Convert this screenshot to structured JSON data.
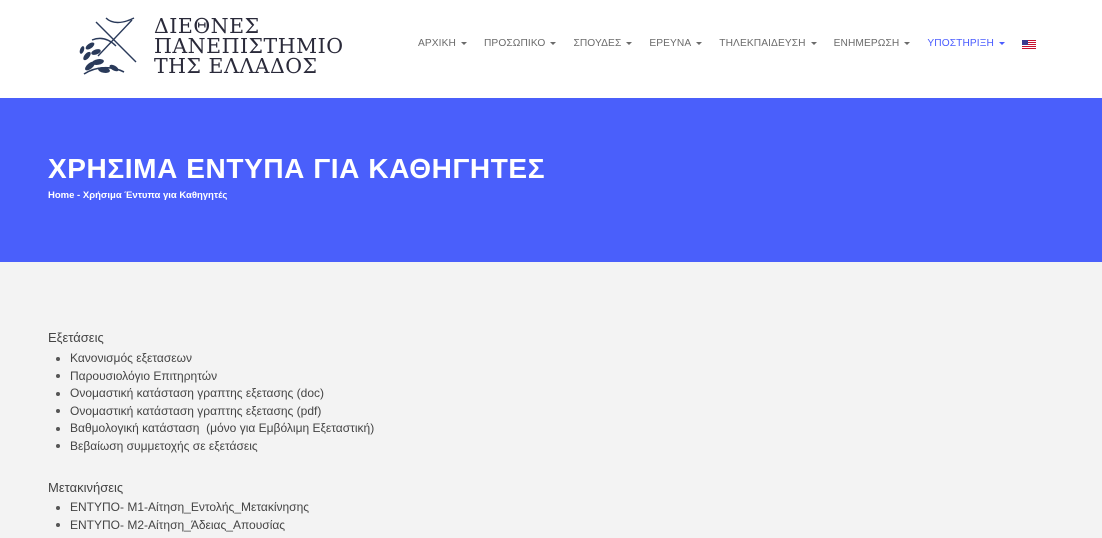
{
  "header": {
    "logo": {
      "line1": "ΔΙΕΘΝΕΣ",
      "line2": "ΠΑΝΕΠΙΣΤΗΜΙΟ",
      "line3": "ΤΗΣ ΕΛΛΑΔΟΣ"
    },
    "nav": [
      {
        "label": "ΑΡΧΙΚΗ"
      },
      {
        "label": "ΠΡΟΣΩΠΙΚΟ"
      },
      {
        "label": "ΣΠΟΥΔΕΣ"
      },
      {
        "label": "ΕΡΕΥΝΑ"
      },
      {
        "label": "ΤΗΛΕΚΠΑΙΔΕΥΣΗ"
      },
      {
        "label": "ΕΝΗΜΕΡΩΣΗ"
      },
      {
        "label": "ΥΠΟΣΤΗΡΙΞΗ"
      }
    ],
    "active_nav": "ΥΠΟΣΤΗΡΙΞΗ",
    "language_icon": "us-flag-icon"
  },
  "hero": {
    "title": "ΧΡΗΣΙΜΑ ΕΝΤΥΠΑ ΓΙΑ ΚΑΘΗΓΗΤΕΣ",
    "breadcrumb": {
      "home": "Home",
      "separator": " - ",
      "current": "Χρήσιμα Έντυπα για Καθηγητές"
    }
  },
  "sections": [
    {
      "title": "Εξετάσεις",
      "items": [
        "Κανονισμός εξετασεων",
        "Παρουσιολόγιο Επιτηρητών",
        "Ονομαστική κατάσταση γραπτης εξετασης (doc)",
        "Ονομαστική κατάσταση γραπτης εξετασης (pdf)",
        "Βαθμολογική κατάσταση  (μόνο για Εμβόλιμη Εξεταστική)",
        "Βεβαίωση συμμετοχής σε εξετάσεις"
      ]
    },
    {
      "title": "Μετακινήσεις",
      "items": [
        "ΕΝΤΥΠΟ- Μ1-Αίτηση_Εντολής_Μετακίνησης",
        "ΕΝΤΥΠΟ- Μ2-Αίτηση_Άδειας_Απουσίας"
      ]
    }
  ],
  "colors": {
    "hero_bg": "#4a5ffb",
    "content_bg": "#f3f3f3",
    "nav_text": "#6b6b6b",
    "nav_active": "#4a5cff"
  }
}
